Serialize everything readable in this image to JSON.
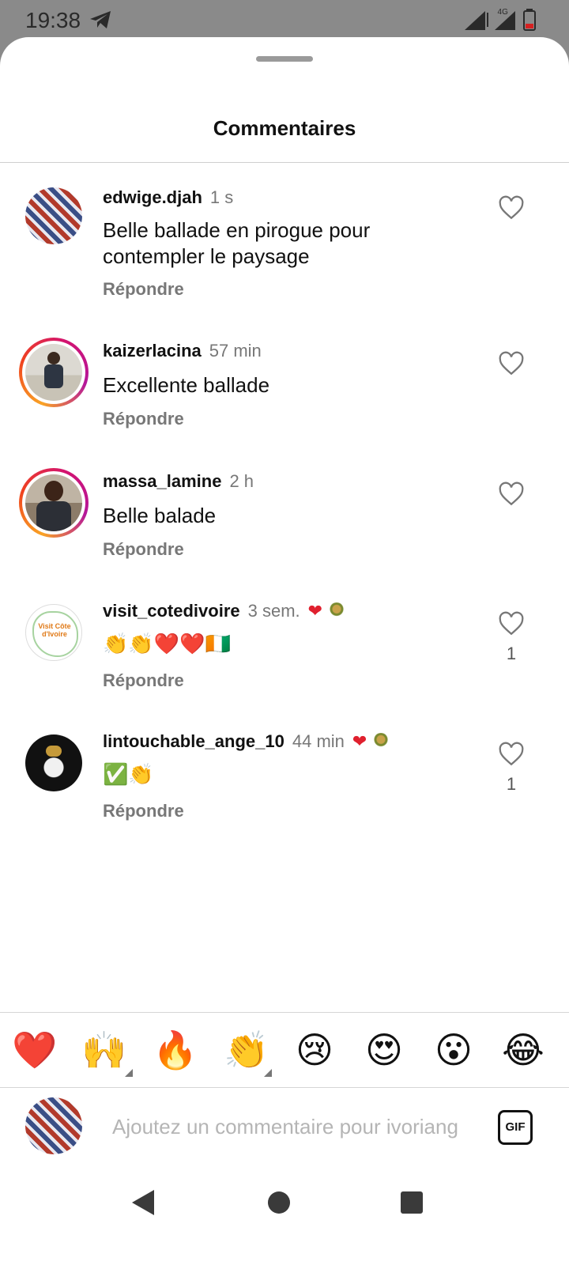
{
  "status_bar": {
    "time": "19:38",
    "network": "4G",
    "icons": [
      "telegram-icon",
      "signal-icon",
      "battery-icon"
    ]
  },
  "sheet": {
    "title": "Commentaires"
  },
  "comments": [
    {
      "username": "edwige.djah",
      "time": "1 s",
      "text": "Belle ballade en pirogue pour contempler le paysage",
      "reply_label": "Répondre",
      "like_count": "",
      "author_liked": false
    },
    {
      "username": "kaizerlacina",
      "time": "57 min",
      "text": "Excellente ballade",
      "reply_label": "Répondre",
      "like_count": "",
      "author_liked": false
    },
    {
      "username": "massa_lamine",
      "time": "2 h",
      "text": "Belle balade",
      "reply_label": "Répondre",
      "like_count": "",
      "author_liked": false
    },
    {
      "username": "visit_cotedivoire",
      "time": "3 sem.",
      "text": "👏👏❤️❤️🇨🇮",
      "reply_label": "Répondre",
      "like_count": "1",
      "author_liked": true,
      "avatar_text": "Visit Côte d'Ivoire"
    },
    {
      "username": "lintouchable_ange_10",
      "time": "44 min",
      "text": "✅👏",
      "reply_label": "Répondre",
      "like_count": "1",
      "author_liked": true
    }
  ],
  "emoji_bar": [
    "❤️",
    "🙌",
    "🔥",
    "👏",
    "😢",
    "😍",
    "😮",
    "😂"
  ],
  "input": {
    "placeholder": "Ajoutez un commentaire pour ivoriang",
    "value": "",
    "gif_label": "GIF"
  },
  "colors": {
    "heart_red": "#e0202e",
    "story_ring": [
      "#f9a325",
      "#f0421f",
      "#d3136f",
      "#b5169a"
    ],
    "muted_text": "#777777"
  }
}
